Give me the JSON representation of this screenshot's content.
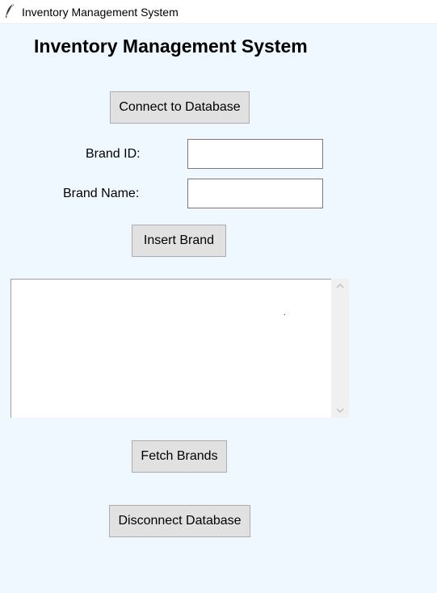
{
  "window": {
    "title": "Inventory Management System"
  },
  "header": {
    "title": "Inventory Management System"
  },
  "buttons": {
    "connect": "Connect to Database",
    "insert": "Insert Brand",
    "fetch": "Fetch Brands",
    "disconnect": "Disconnect Database"
  },
  "form": {
    "brand_id_label": "Brand ID:",
    "brand_id_value": "",
    "brand_name_label": "Brand Name:",
    "brand_name_value": ""
  },
  "results": {
    "items": []
  },
  "icons": {
    "app": "feather-icon",
    "scroll_up": "chevron-up-icon",
    "scroll_down": "chevron-down-icon"
  },
  "colors": {
    "background": "#f0f8ff",
    "button_face": "#e1e1e1",
    "button_border": "#adadad"
  }
}
